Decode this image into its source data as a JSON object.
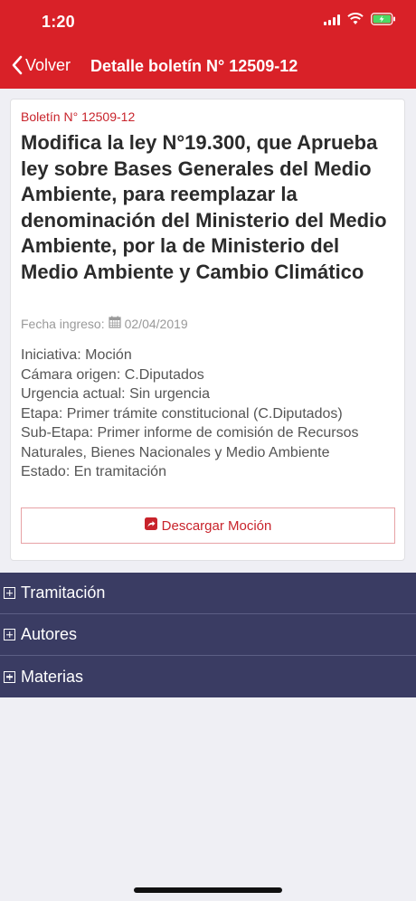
{
  "status_bar": {
    "time": "1:20"
  },
  "nav": {
    "back_label": "Volver",
    "title": "Detalle boletín N° 12509-12"
  },
  "bill": {
    "number_label": "Boletín N° 12509-12",
    "title": "Modifica la ley N°19.300, que Aprueba ley sobre Bases Generales del Medio Ambiente, para reemplazar la denominación del Ministerio del Medio Ambiente, por la de Ministerio del Medio Ambiente y Cambio Climático",
    "fecha_label": "Fecha ingreso:",
    "fecha_value": "02/04/2019",
    "iniciativa": "Iniciativa: Moción",
    "camara": "Cámara origen: C.Diputados",
    "urgencia": "Urgencia actual: Sin urgencia",
    "etapa": "Etapa: Primer trámite constitucional (C.Diputados)",
    "sub_etapa": "Sub-Etapa: Primer informe de comisión de Recursos Naturales, Bienes Nacionales y Medio Ambiente",
    "estado": "Estado: En tramitación",
    "download_label": "Descargar Moción"
  },
  "sections": [
    "Tramitación",
    "Autores",
    "Materias"
  ],
  "colors": {
    "header": "#d92128",
    "accordion": "#3a3c63",
    "accent": "#c8232b"
  }
}
